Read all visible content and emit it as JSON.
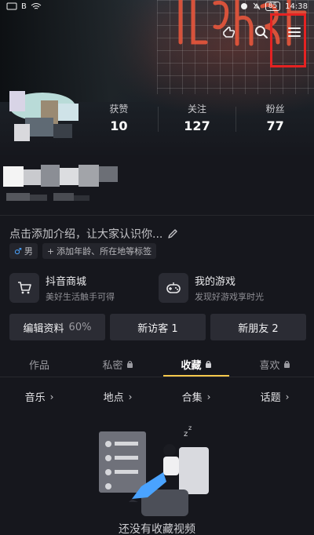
{
  "status_bar": {
    "left_text": "B",
    "battery": "85",
    "time": "14:38"
  },
  "stats": [
    {
      "label": "获赞",
      "value": "10"
    },
    {
      "label": "关注",
      "value": "127"
    },
    {
      "label": "粉丝",
      "value": "77"
    }
  ],
  "intro": {
    "text": "点击添加介绍，让大家认识你..."
  },
  "tags": {
    "gender": "男",
    "add_tag": "添加年龄、所在地等标签"
  },
  "features": [
    {
      "title": "抖音商城",
      "subtitle": "美好生活触手可得",
      "icon": "cart-icon"
    },
    {
      "title": "我的游戏",
      "subtitle": "发现好游戏享时光",
      "icon": "gamepad-icon"
    }
  ],
  "actions": [
    {
      "label": "编辑资料",
      "extra": "60%"
    },
    {
      "label": "新访客 1",
      "extra": ""
    },
    {
      "label": "新朋友 2",
      "extra": ""
    }
  ],
  "tabs": [
    {
      "label": "作品",
      "locked": false
    },
    {
      "label": "私密",
      "locked": true
    },
    {
      "label": "收藏",
      "locked": true
    },
    {
      "label": "喜欢",
      "locked": true
    }
  ],
  "subfilters": [
    {
      "label": "音乐"
    },
    {
      "label": "地点"
    },
    {
      "label": "合集"
    },
    {
      "label": "话题"
    }
  ],
  "empty_state": {
    "text": "还没有收藏视频"
  },
  "colors": {
    "background": "#16171d",
    "active_tab_underline": "#f5c84c",
    "highlight_box": "#e52222"
  }
}
